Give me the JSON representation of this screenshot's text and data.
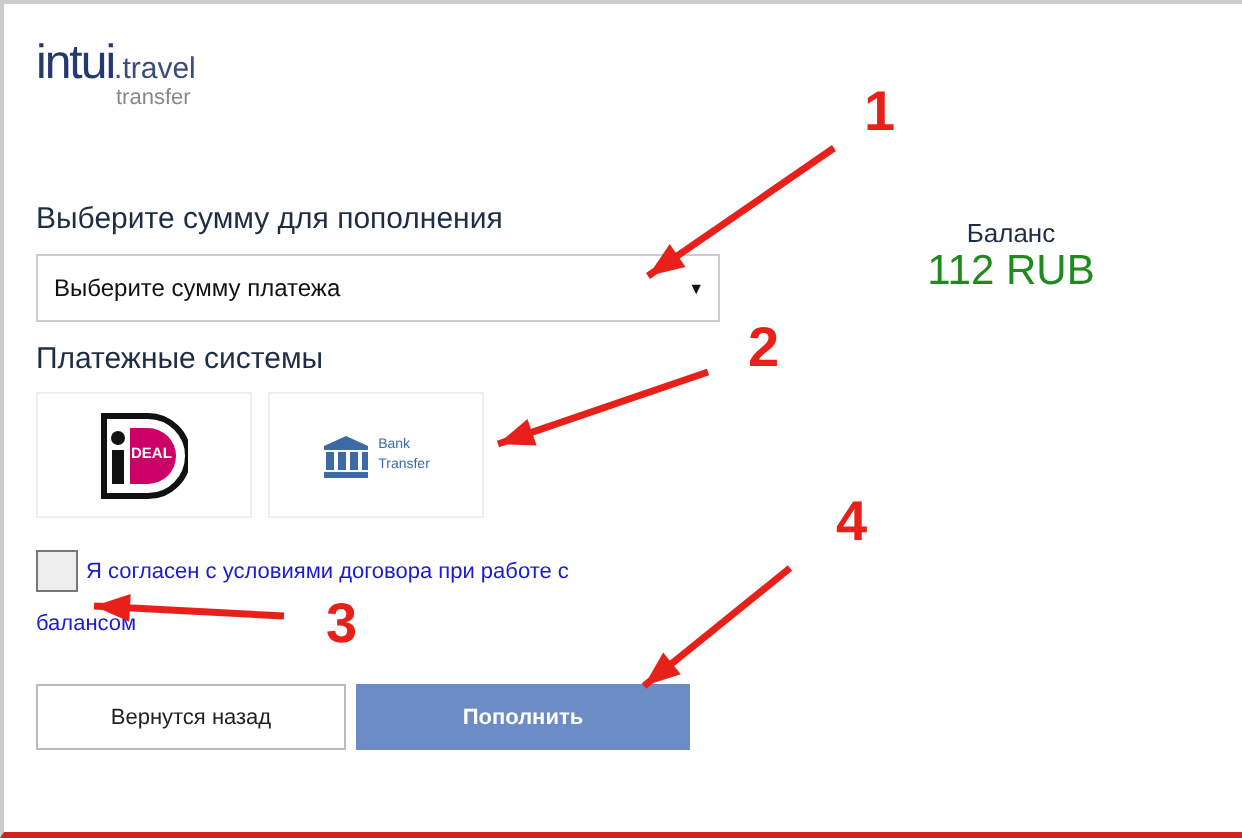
{
  "logo": {
    "brand": "intui",
    "domain": ".travel",
    "sub": "transfer"
  },
  "amount": {
    "heading": "Выберите сумму для пополнения",
    "select_value": "Выберите сумму платежа",
    "caret": "▼"
  },
  "payment_systems": {
    "heading": "Платежные системы",
    "options": [
      {
        "kind": "ideal",
        "lines": [
          "DEAL"
        ]
      },
      {
        "kind": "bank",
        "lines": [
          "Bank",
          "Transfer"
        ]
      }
    ]
  },
  "agreement": {
    "checked": false,
    "lines": [
      "Я согласен с условиями договора при работе с",
      "балансом"
    ]
  },
  "buttons": [
    {
      "kind": "back",
      "label": "Вернутся назад"
    },
    {
      "kind": "primary",
      "label": "Пополнить"
    }
  ],
  "balance": {
    "label": "Баланс",
    "amount": "112 RUB"
  },
  "annotations": [
    {
      "label": "1"
    },
    {
      "label": "2"
    },
    {
      "label": "3"
    },
    {
      "label": "4"
    }
  ]
}
